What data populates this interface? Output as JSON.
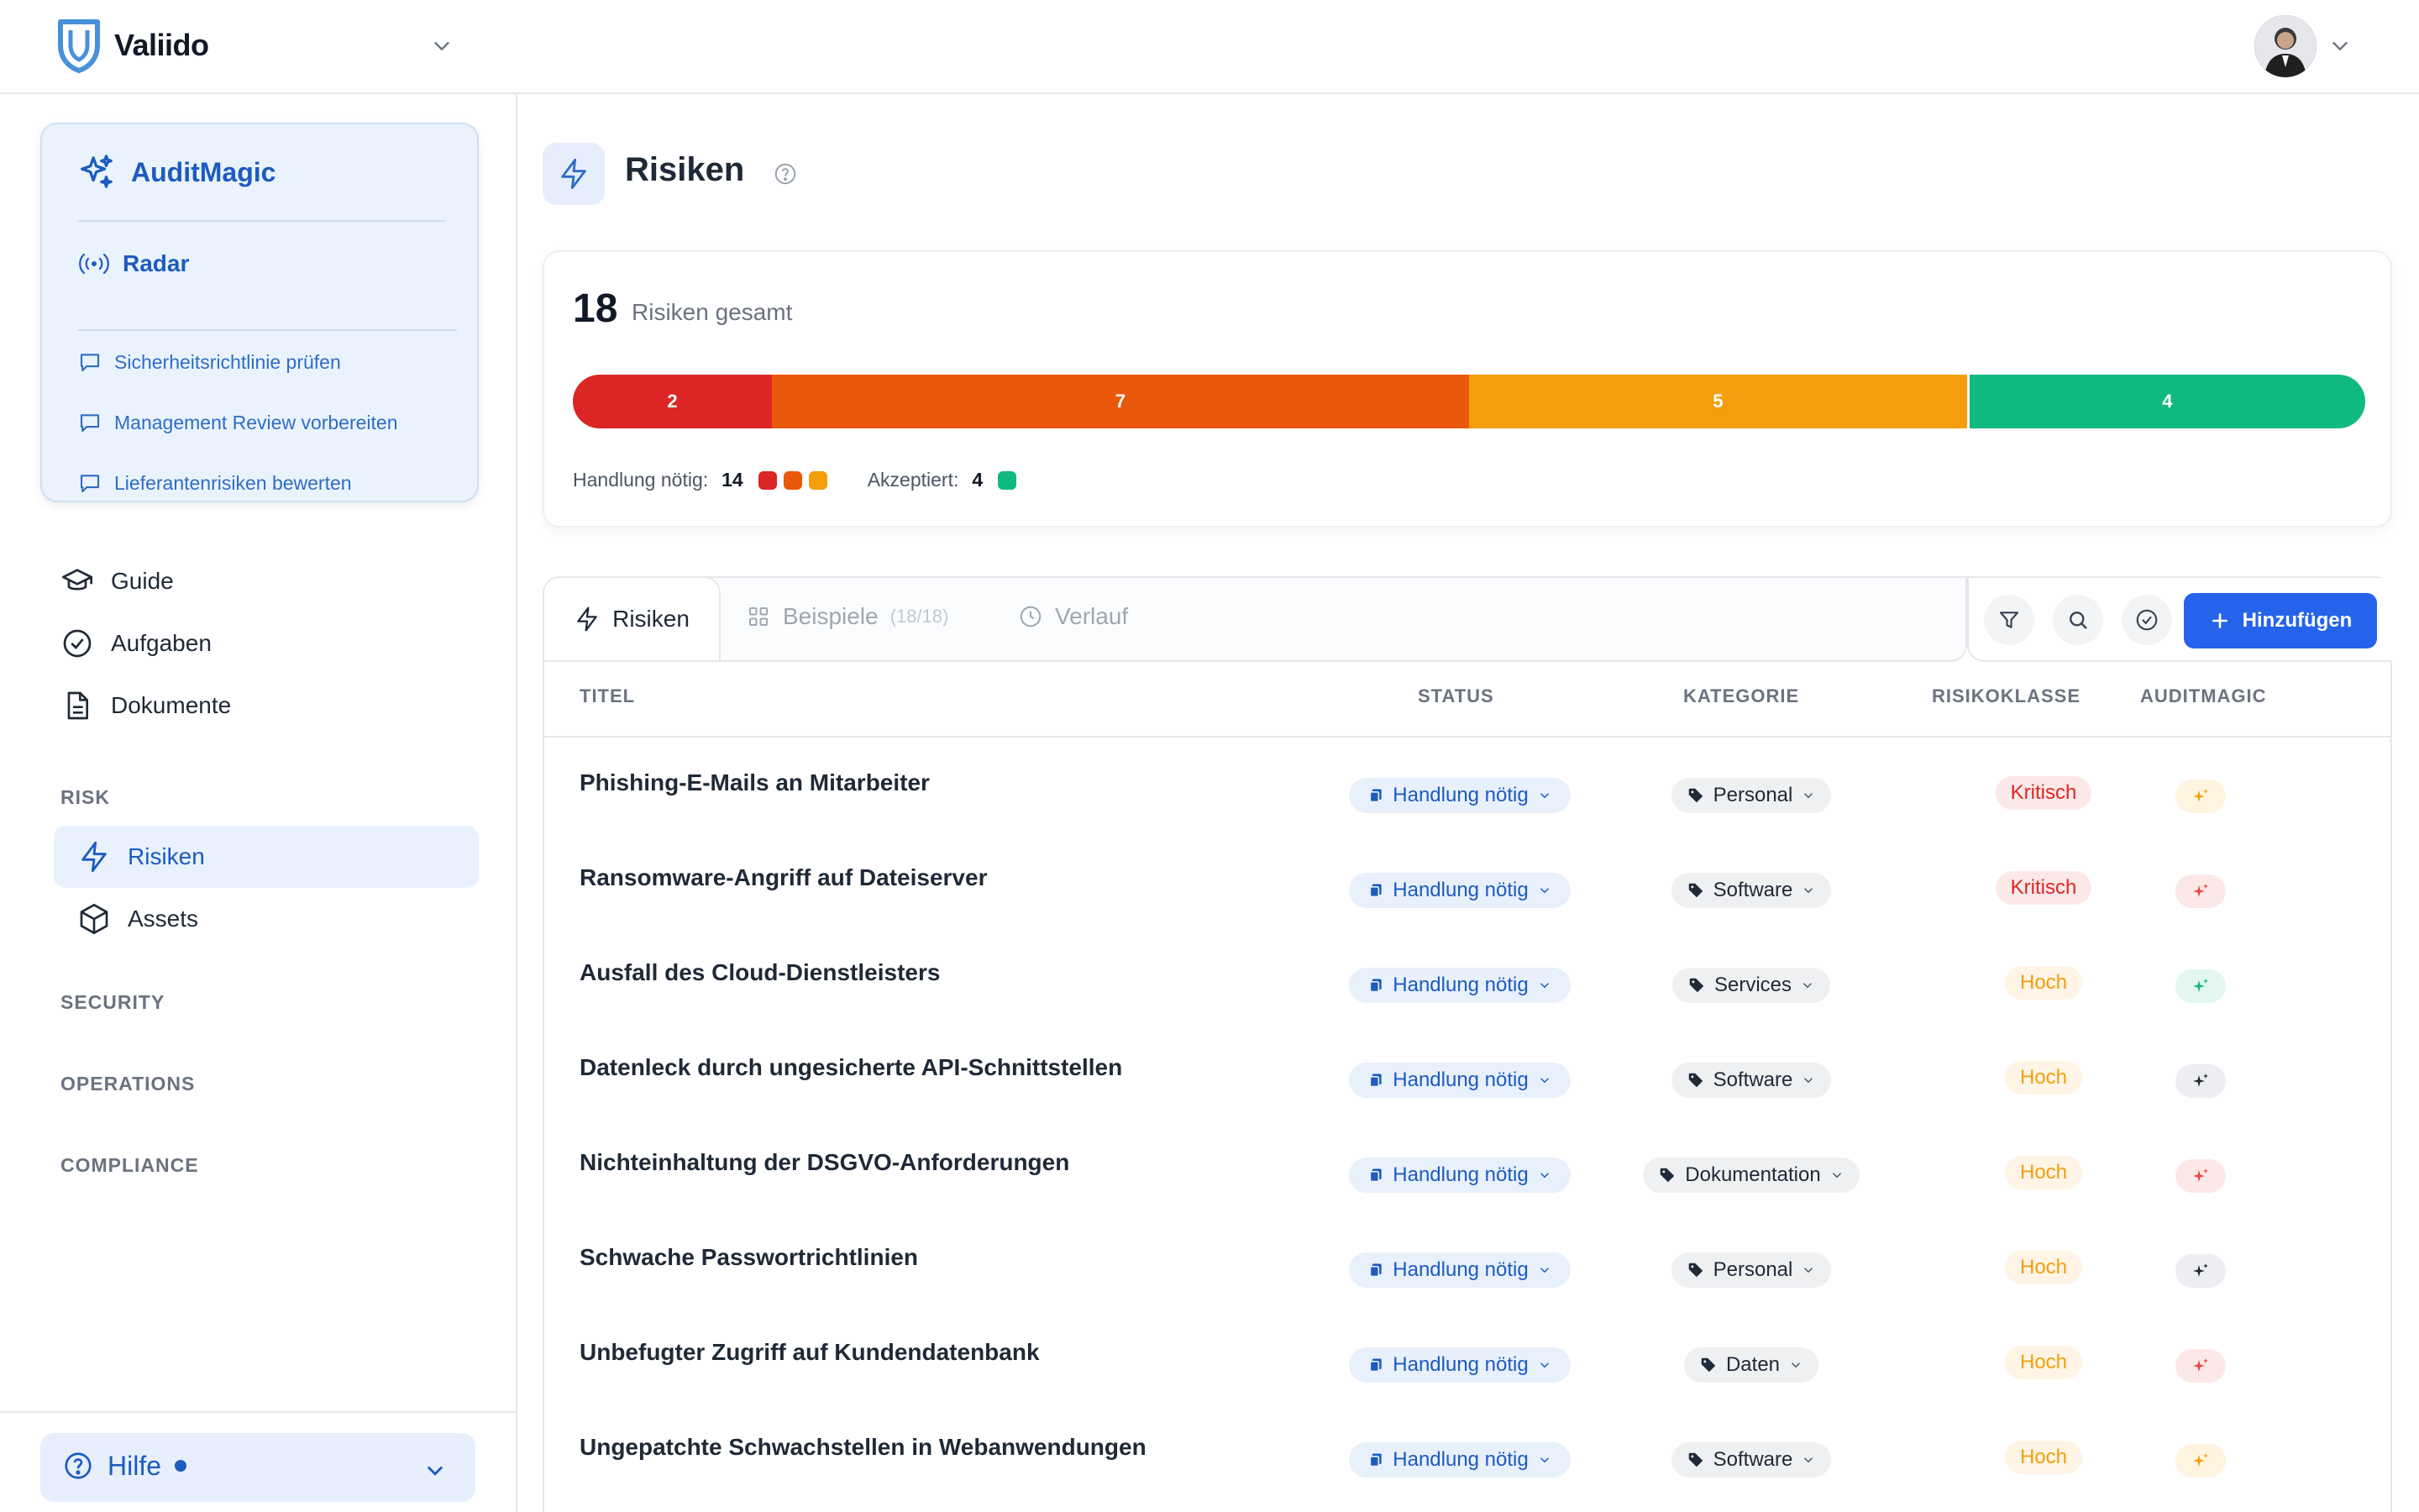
{
  "app": {
    "brand": "Valiido"
  },
  "sidebar": {
    "auditmagic": {
      "title": "AuditMagic",
      "radar": "Radar",
      "chats": [
        "Sicherheitsrichtlinie prüfen",
        "Management Review vorbereiten",
        "Lieferantenrisiken bewerten"
      ]
    },
    "nav": {
      "guide": "Guide",
      "tasks": "Aufgaben",
      "documents": "Dokumente"
    },
    "sections": {
      "risk": "RISK",
      "security": "SECURITY",
      "operations": "OPERATIONS",
      "compliance": "COMPLIANCE"
    },
    "risk_items": {
      "risks": "Risiken",
      "assets": "Assets"
    },
    "help": "Hilfe"
  },
  "page": {
    "title": "Risiken"
  },
  "summary": {
    "total": "18",
    "total_label": "Risiken gesamt",
    "segments": [
      {
        "value": 2,
        "color": "#dc2626"
      },
      {
        "value": 7,
        "color": "#ea580c"
      },
      {
        "value": 5,
        "color": "#f59e0b"
      },
      {
        "value": 4,
        "color": "#10b981"
      }
    ],
    "action_label": "Handlung nötig:",
    "action_count": "14",
    "accepted_label": "Akzeptiert:",
    "accepted_count": "4"
  },
  "tabs": {
    "risks": "Risiken",
    "examples": "Beispiele",
    "examples_count": "(18/18)",
    "history": "Verlauf"
  },
  "toolbar": {
    "add": "Hinzufügen"
  },
  "table": {
    "headers": {
      "title": "TITEL",
      "status": "STATUS",
      "category": "KATEGORIE",
      "risk_class": "RISIKOKLASSE",
      "auditmagic": "AUDITMAGIC"
    },
    "rows": [
      {
        "title": "Phishing-E-Mails an Mitarbeiter",
        "status": "Handlung nötig",
        "category": "Personal",
        "risk": "Kritisch",
        "ai_color": "#f59e0b"
      },
      {
        "title": "Ransomware-Angriff auf Dateiserver",
        "status": "Handlung nötig",
        "category": "Software",
        "risk": "Kritisch",
        "ai_color": "#ef4444"
      },
      {
        "title": "Ausfall des Cloud-Dienstleisters",
        "status": "Handlung nötig",
        "category": "Services",
        "risk": "Hoch",
        "ai_color": "#10b981"
      },
      {
        "title": "Datenleck durch ungesicherte API-Schnittstellen",
        "status": "Handlung nötig",
        "category": "Software",
        "risk": "Hoch",
        "ai_color": "#1f2937"
      },
      {
        "title": "Nichteinhaltung der DSGVO-Anforderungen",
        "status": "Handlung nötig",
        "category": "Dokumentation",
        "risk": "Hoch",
        "ai_color": "#ef4444"
      },
      {
        "title": "Schwache Passwortrichtlinien",
        "status": "Handlung nötig",
        "category": "Personal",
        "risk": "Hoch",
        "ai_color": "#1f2937"
      },
      {
        "title": "Unbefugter Zugriff auf Kundendatenbank",
        "status": "Handlung nötig",
        "category": "Daten",
        "risk": "Hoch",
        "ai_color": "#ef4444"
      },
      {
        "title": "Ungepatchte Schwachstellen in Webanwendungen",
        "status": "Handlung nötig",
        "category": "Software",
        "risk": "Hoch",
        "ai_color": "#f59e0b"
      }
    ]
  }
}
